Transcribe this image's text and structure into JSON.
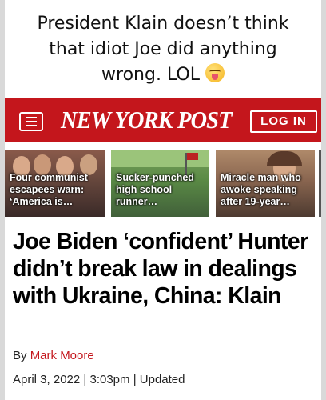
{
  "caption": {
    "line1": "President Klain doesn’t think",
    "line2": "that idiot Joe did anything",
    "line3": "wrong. LOL"
  },
  "emoji": "squinting-face-with-tongue",
  "header": {
    "logo": "NEW YORK POST",
    "login_label": "LOG IN"
  },
  "stories": [
    {
      "text": "Four communist escapees warn: ‘America is…"
    },
    {
      "text": "Sucker-punched high school runner…"
    },
    {
      "text": "Miracle man who awoke speaking after 19-year…"
    }
  ],
  "article": {
    "headline": "Joe Biden ‘confident’ Hunter didn’t break law in dealings with Ukraine, China: Klain",
    "byline_prefix": "By",
    "author": "Mark Moore",
    "date": "April 3, 2022",
    "separator": "|",
    "time": "3:03pm",
    "updated": "Updated"
  },
  "colors": {
    "brand_red": "#c4161c"
  }
}
